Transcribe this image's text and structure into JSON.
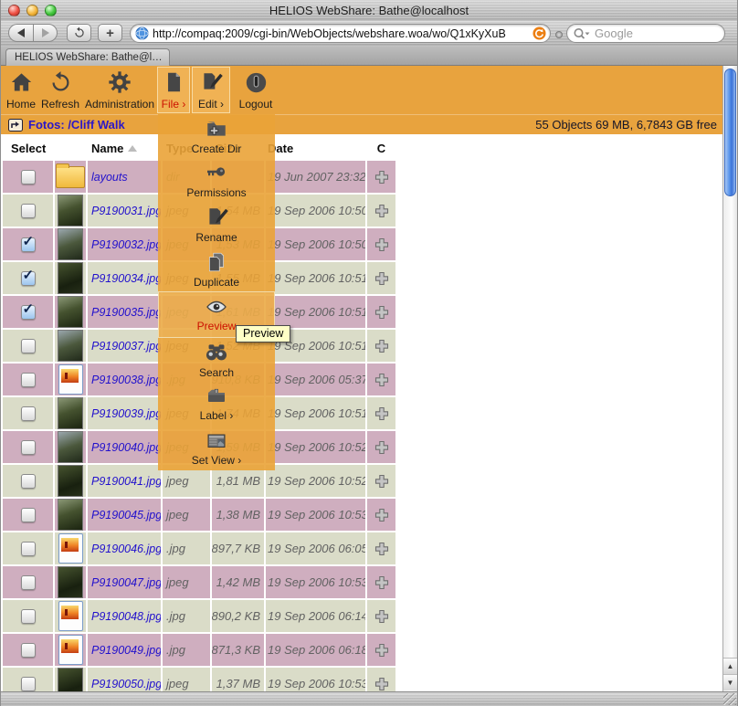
{
  "window": {
    "title": "HELIOS WebShare: Bathe@localhost",
    "url": "http://compaq:2009/cgi-bin/WebObjects/webshare.woa/wo/Q1xKyXuB",
    "search_placeholder": "Google",
    "tab_label": "HELIOS WebShare: Bathe@l…"
  },
  "toolbar": {
    "items": [
      {
        "label": "Home"
      },
      {
        "label": "Refresh"
      },
      {
        "label": "Administration"
      },
      {
        "label": "File ›"
      },
      {
        "label": "Edit ›"
      },
      {
        "label": "Logout"
      }
    ]
  },
  "breadcrumb": {
    "path_label": "Fotos: /Cliff Walk",
    "stats": "55 Objects 69 MB, 6,7843 GB free"
  },
  "file_menu": {
    "items": [
      "Create Dir",
      "Permissions",
      "Rename",
      "Duplicate",
      "Preview",
      "Search",
      "Label ›",
      "Set View ›"
    ],
    "active_item": "Preview",
    "tooltip": "Preview"
  },
  "table": {
    "headers": [
      "Select",
      "Name",
      "Type",
      "Size",
      "Date",
      "C"
    ],
    "sort_column": "Name",
    "sort_direction": "ascending",
    "rows": [
      {
        "name": "layouts",
        "type": "dir",
        "size": "",
        "date": "19 Jun 2007 23:32",
        "checked": false,
        "thumb": "folder"
      },
      {
        "name": "P9190031.jpg",
        "type": "jpeg",
        "size": "1,54 MB",
        "date": "19 Sep 2006 10:50",
        "checked": false,
        "thumb": "photo"
      },
      {
        "name": "P9190032.jpg",
        "type": "jpeg",
        "size": "1,53 MB",
        "date": "19 Sep 2006 10:50",
        "checked": true,
        "thumb": "photo"
      },
      {
        "name": "P9190034.jpg",
        "type": "jpeg",
        "size": "1,55 MB",
        "date": "19 Sep 2006 10:51",
        "checked": true,
        "thumb": "photo"
      },
      {
        "name": "P9190035.jpg",
        "type": "jpeg",
        "size": "1,61 MB",
        "date": "19 Sep 2006 10:51",
        "checked": true,
        "thumb": "photo"
      },
      {
        "name": "P9190037.jpg",
        "type": "jpeg",
        "size": "1,52 MB",
        "date": "19 Sep 2006 10:51",
        "checked": false,
        "thumb": "photo"
      },
      {
        "name": "P9190038.jpg",
        "type": ".jpg",
        "size": "910,8 KB",
        "date": "19 Sep 2006 05:37",
        "checked": false,
        "thumb": "doc"
      },
      {
        "name": "P9190039.jpg",
        "type": "jpeg",
        "size": "1,74 MB",
        "date": "19 Sep 2006 10:51",
        "checked": false,
        "thumb": "photo"
      },
      {
        "name": "P9190040.jpg",
        "type": "jpeg",
        "size": "1,59 MB",
        "date": "19 Sep 2006 10:52",
        "checked": false,
        "thumb": "photo"
      },
      {
        "name": "P9190041.jpg",
        "type": "jpeg",
        "size": "1,81 MB",
        "date": "19 Sep 2006 10:52",
        "checked": false,
        "thumb": "photo"
      },
      {
        "name": "P9190045.jpg",
        "type": "jpeg",
        "size": "1,38 MB",
        "date": "19 Sep 2006 10:53",
        "checked": false,
        "thumb": "photo"
      },
      {
        "name": "P9190046.jpg",
        "type": ".jpg",
        "size": "897,7 KB",
        "date": "19 Sep 2006 06:05",
        "checked": false,
        "thumb": "doc"
      },
      {
        "name": "P9190047.jpg",
        "type": "jpeg",
        "size": "1,42 MB",
        "date": "19 Sep 2006 10:53",
        "checked": false,
        "thumb": "photo"
      },
      {
        "name": "P9190048.jpg",
        "type": ".jpg",
        "size": "890,2 KB",
        "date": "19 Sep 2006 06:14",
        "checked": false,
        "thumb": "doc"
      },
      {
        "name": "P9190049.jpg",
        "type": ".jpg",
        "size": "871,3 KB",
        "date": "19 Sep 2006 06:18",
        "checked": false,
        "thumb": "doc"
      },
      {
        "name": "P9190050.jpg",
        "type": "jpeg",
        "size": "1,37 MB",
        "date": "19 Sep 2006 10:53",
        "checked": false,
        "thumb": "photo"
      }
    ]
  },
  "colors": {
    "toolbar_orange": "#e8a33e",
    "row_pink": "#cfaebf",
    "row_green": "#dadcc8",
    "link_blue": "#2211cc",
    "active_red": "#cc1100",
    "tooltip_yellow": "#ffffc6",
    "scrollbar_blue": "#5d97ec"
  }
}
